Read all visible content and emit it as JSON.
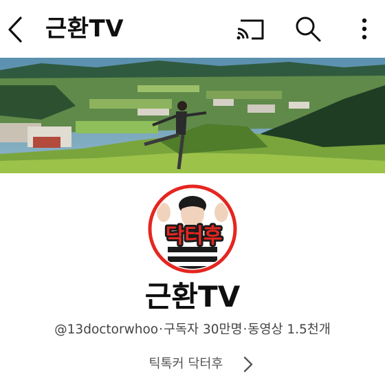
{
  "header": {
    "title": "근환TV",
    "icons": [
      "back-arrow-icon",
      "cast-icon",
      "search-icon",
      "more-vertical-icon"
    ]
  },
  "channel": {
    "avatar_badge": "닥터후",
    "name": "근환TV",
    "handle": "@13doctorwhoo",
    "separator": "·",
    "subscribers": "구독자 30만명",
    "videos": "동영상 1.5천개",
    "link_text": "틱톡커 닥터후"
  },
  "colors": {
    "avatar_ring": "#e52620",
    "badge_green": "#2a9d3a",
    "badge_red": "#d9221c"
  }
}
